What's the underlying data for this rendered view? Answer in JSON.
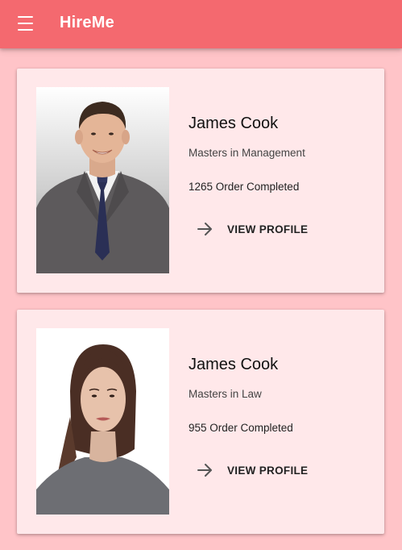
{
  "appbar": {
    "title": "HireMe",
    "menu_icon": "hamburger-menu-icon",
    "color": "#f4696f"
  },
  "background_color": "#ffc4c8",
  "card_color": "#ffe8ea",
  "profiles": [
    {
      "name": "James Cook",
      "degree": "Masters in Management",
      "orders": "1265 Order Completed",
      "action_label": "VIEW PROFILE",
      "action_icon": "arrow-right-icon",
      "photo": "man-in-suit-portrait"
    },
    {
      "name": "James Cook",
      "degree": "Masters in Law",
      "orders": "955 Order Completed",
      "action_label": "VIEW PROFILE",
      "action_icon": "arrow-right-icon",
      "photo": "woman-portrait"
    }
  ]
}
